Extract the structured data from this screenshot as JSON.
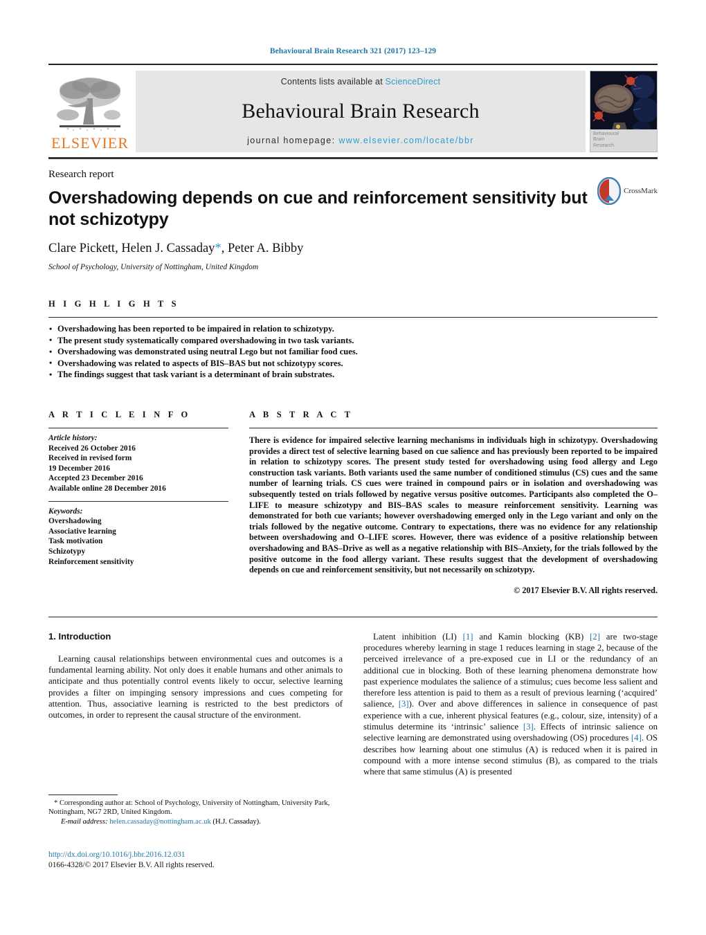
{
  "running_head": "Behavioural Brain Research 321 (2017) 123–129",
  "masthead": {
    "publisher_name": "ELSEVIER",
    "contents_prefix": "Contents lists available at ",
    "contents_link": "ScienceDirect",
    "journal_title": "Behavioural Brain Research",
    "homepage_prefix": "journal homepage: ",
    "homepage_url": "www.elsevier.com/locate/bbr",
    "cover_caption_line1": "Behavioural",
    "cover_caption_line2": "Brain",
    "cover_caption_line3": "Research"
  },
  "article": {
    "kicker": "Research report",
    "title": "Overshadowing depends on cue and reinforcement sensitivity but not schizotypy",
    "authors_pre": "Clare Pickett, Helen J. Cassaday",
    "authors_star": "*",
    "authors_post": ", Peter A. Bibby",
    "affiliation": "School of Psychology, University of Nottingham, United Kingdom",
    "crossmark_label": "CrossMark"
  },
  "highlights": {
    "label": "H I G H L I G H T S",
    "items": [
      "Overshadowing has been reported to be impaired in relation to schizotypy.",
      "The present study systematically compared overshadowing in two task variants.",
      "Overshadowing was demonstrated using neutral Lego but not familiar food cues.",
      "Overshadowing was related to aspects of BIS–BAS but not schizotypy scores.",
      "The findings suggest that task variant is a determinant of brain substrates."
    ]
  },
  "article_info": {
    "label": "A R T I C L E   I N F O",
    "history_heading": "Article history:",
    "history_lines": [
      "Received 26 October 2016",
      "Received in revised form",
      "19 December 2016",
      "Accepted 23 December 2016",
      "Available online 28 December 2016"
    ],
    "keywords_heading": "Keywords:",
    "keywords": [
      "Overshadowing",
      "Associative learning",
      "Task motivation",
      "Schizotypy",
      "Reinforcement sensitivity"
    ]
  },
  "abstract": {
    "label": "A B S T R A C T",
    "text": "There is evidence for impaired selective learning mechanisms in individuals high in schizotypy. Overshadowing provides a direct test of selective learning based on cue salience and has previously been reported to be impaired in relation to schizotypy scores. The present study tested for overshadowing using food allergy and Lego construction task variants. Both variants used the same number of conditioned stimulus (CS) cues and the same number of learning trials. CS cues were trained in compound pairs or in isolation and overshadowing was subsequently tested on trials followed by negative versus positive outcomes. Participants also completed the O–LIFE to measure schizotypy and BIS–BAS scales to measure reinforcement sensitivity. Learning was demonstrated for both cue variants; however overshadowing emerged only in the Lego variant and only on the trials followed by the negative outcome. Contrary to expectations, there was no evidence for any relationship between overshadowing and O–LIFE scores. However, there was evidence of a positive relationship between overshadowing and BAS–Drive as well as a negative relationship with BIS–Anxiety, for the trials followed by the positive outcome in the food allergy variant. These results suggest that the development of overshadowing depends on cue and reinforcement sensitivity, but not necessarily on schizotypy.",
    "copyright": "© 2017 Elsevier B.V. All rights reserved."
  },
  "body": {
    "section_number_title": "1.  Introduction",
    "left_paragraph": "Learning causal relationships between environmental cues and outcomes is a fundamental learning ability. Not only does it enable humans and other animals to anticipate and thus potentially control events likely to occur, selective learning provides a filter on impinging sensory impressions and cues competing for attention. Thus, associative learning is restricted to the best predictors of outcomes, in order to represent the causal structure of the environment.",
    "right_paragraph_part1": "Latent inhibition (LI) ",
    "right_ref1": "[1]",
    "right_paragraph_part2": " and Kamin blocking (KB) ",
    "right_ref2": "[2]",
    "right_paragraph_part3": " are two-stage procedures whereby learning in stage 1 reduces learning in stage 2, because of the perceived irrelevance of a pre-exposed cue in LI or the redundancy of an additional cue in blocking. Both of these learning phenomena demonstrate how past experience modulates the salience of a stimulus; cues become less salient and therefore less attention is paid to them as a result of previous learning (‘acquired’ salience, ",
    "right_ref3": "[3]",
    "right_paragraph_part4": "). Over and above differences in salience in consequence of past experience with a cue, inherent physical features (e.g., colour, size, intensity) of a stimulus determine its ‘intrinsic’ salience ",
    "right_ref4": "[3]",
    "right_paragraph_part5": ". Effects of intrinsic salience on selective learning are demonstrated using overshadowing (OS) procedures ",
    "right_ref5": "[4]",
    "right_paragraph_part6": ". OS describes how learning about one stimulus (A) is reduced when it is paired in compound with a more intense second stimulus (B), as compared to the trials where that same stimulus (A) is presented"
  },
  "footnote": {
    "star": "*",
    "corresponding_text": " Corresponding author at: School of Psychology, University of Nottingham, University Park, Nottingham, NG7 2RD, United Kingdom.",
    "email_label": "E-mail address:",
    "email": "helen.cassaday@nottingham.ac.uk",
    "email_suffix": " (H.J. Cassaday).",
    "doi": "http://dx.doi.org/10.1016/j.bbr.2016.12.031",
    "issn_line": "0166-4328/© 2017 Elsevier B.V. All rights reserved."
  },
  "colors": {
    "link_blue": "#2077a8",
    "sciencedirect_blue": "#2e9ccc",
    "elsevier_orange": "#e87722",
    "band_grey": "#e6e6e6"
  }
}
